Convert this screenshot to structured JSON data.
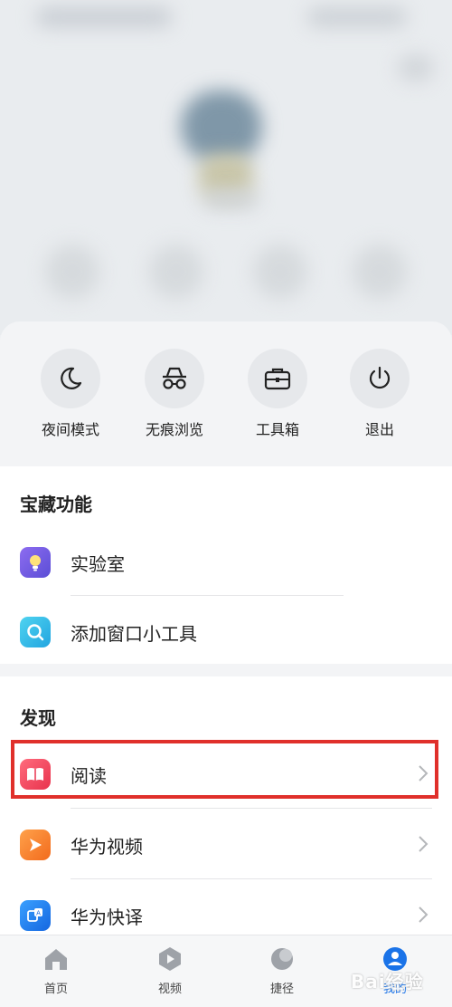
{
  "quick_actions": [
    {
      "label": "夜间模式",
      "icon": "moon-icon"
    },
    {
      "label": "无痕浏览",
      "icon": "incognito-icon"
    },
    {
      "label": "工具箱",
      "icon": "toolbox-icon"
    },
    {
      "label": "退出",
      "icon": "power-icon"
    }
  ],
  "treasure": {
    "title": "宝藏功能",
    "items": [
      {
        "label": "实验室",
        "icon": "bulb-icon"
      },
      {
        "label": "添加窗口小工具",
        "icon": "magnifier-widget-icon"
      }
    ]
  },
  "discover": {
    "title": "发现",
    "items": [
      {
        "label": "阅读",
        "icon": "book-icon"
      },
      {
        "label": "华为视频",
        "icon": "video-play-icon"
      },
      {
        "label": "华为快译",
        "icon": "translate-icon"
      }
    ]
  },
  "tabbar": {
    "tabs": [
      {
        "label": "首页",
        "icon": "home-icon"
      },
      {
        "label": "视频",
        "icon": "video-icon"
      },
      {
        "label": "捷径",
        "icon": "shortcut-icon"
      },
      {
        "label": "我的",
        "icon": "profile-icon"
      }
    ],
    "active_index": 3
  },
  "watermark": "Bai经验",
  "colors": {
    "highlight": "#e0302b",
    "active_tab": "#1a73e8"
  }
}
